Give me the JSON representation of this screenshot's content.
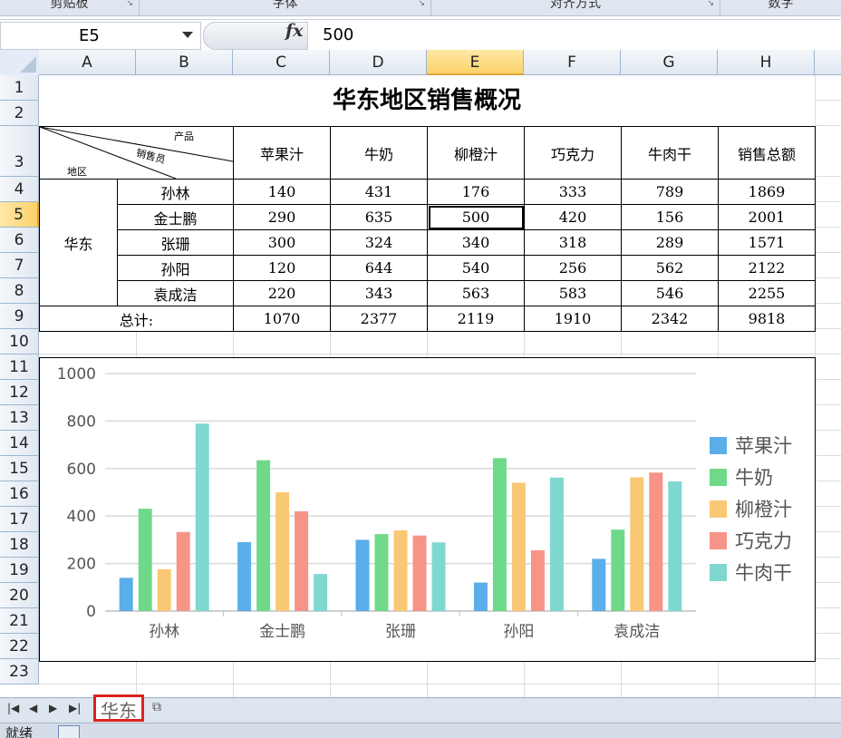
{
  "ribbon": {
    "groups": [
      {
        "label": "剪贴板"
      },
      {
        "label": "字体"
      },
      {
        "label": "对齐方式"
      },
      {
        "label": "数字"
      }
    ]
  },
  "formula_bar": {
    "name_box": "E5",
    "fx_label": "fx",
    "value": "500"
  },
  "columns": [
    "A",
    "B",
    "C",
    "D",
    "E",
    "F",
    "G",
    "H"
  ],
  "selected_column": "E",
  "rows": [
    "1",
    "2",
    "3",
    "4",
    "5",
    "6",
    "7",
    "8",
    "9",
    "10",
    "11",
    "12",
    "13",
    "14",
    "15",
    "16",
    "17",
    "18",
    "19",
    "20",
    "21",
    "22",
    "23"
  ],
  "selected_row": "5",
  "table": {
    "title": "华东地区销售概况",
    "header_corner": {
      "product": "产品",
      "salesperson": "销售员",
      "region": "地区"
    },
    "products": [
      "苹果汁",
      "牛奶",
      "柳橙汁",
      "巧克力",
      "牛肉干",
      "销售总额"
    ],
    "region": "华东",
    "rows": [
      {
        "name": "孙林",
        "values": [
          "140",
          "431",
          "176",
          "333",
          "789",
          "1869"
        ]
      },
      {
        "name": "金士鹏",
        "values": [
          "290",
          "635",
          "500",
          "420",
          "156",
          "2001"
        ]
      },
      {
        "name": "张珊",
        "values": [
          "300",
          "324",
          "340",
          "318",
          "289",
          "1571"
        ]
      },
      {
        "name": "孙阳",
        "values": [
          "120",
          "644",
          "540",
          "256",
          "562",
          "2122"
        ]
      },
      {
        "name": "袁成洁",
        "values": [
          "220",
          "343",
          "563",
          "583",
          "546",
          "2255"
        ]
      }
    ],
    "total_label": "总计:",
    "totals": [
      "1070",
      "2377",
      "2119",
      "1910",
      "2342",
      "9818"
    ]
  },
  "chart_data": {
    "type": "bar",
    "categories": [
      "孙林",
      "金士鹏",
      "张珊",
      "孙阳",
      "袁成洁"
    ],
    "series": [
      {
        "name": "苹果汁",
        "values": [
          140,
          290,
          300,
          120,
          220
        ],
        "color": "#5aaee9"
      },
      {
        "name": "牛奶",
        "values": [
          431,
          635,
          324,
          644,
          343
        ],
        "color": "#6fd98a"
      },
      {
        "name": "柳橙汁",
        "values": [
          176,
          500,
          340,
          540,
          563
        ],
        "color": "#f9c875"
      },
      {
        "name": "巧克力",
        "values": [
          333,
          420,
          318,
          256,
          583
        ],
        "color": "#f69488"
      },
      {
        "name": "牛肉干",
        "values": [
          789,
          156,
          289,
          562,
          546
        ],
        "color": "#7ed8d0"
      }
    ],
    "yticks": [
      "0",
      "200",
      "400",
      "600",
      "800",
      "1000"
    ],
    "ylim": [
      0,
      1000
    ],
    "grid": true,
    "legend": "right"
  },
  "sheet_tabs": {
    "active": "华东"
  },
  "status": {
    "text": "就绪"
  }
}
